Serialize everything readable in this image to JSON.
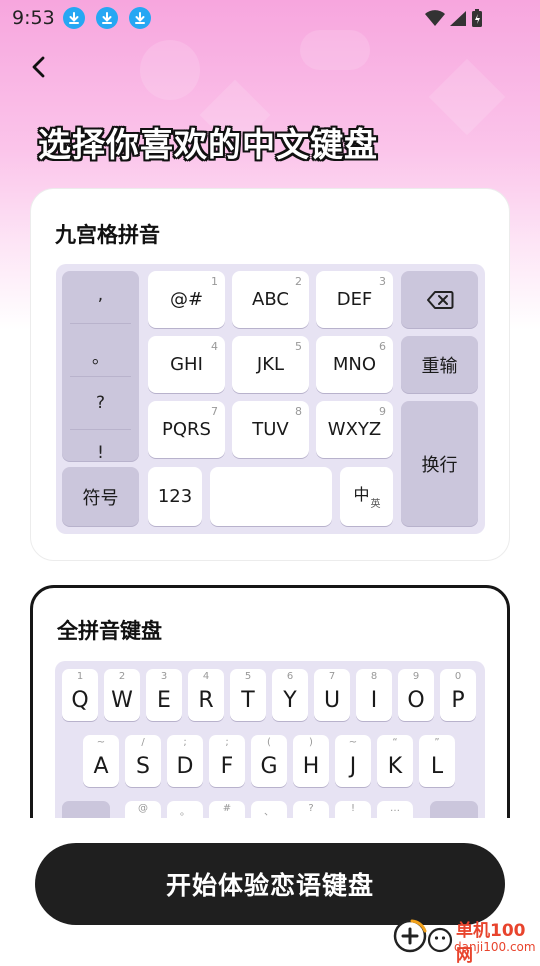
{
  "status_bar": {
    "time": "9:53"
  },
  "page": {
    "title": "选择你喜欢的中文键盘"
  },
  "card_nine": {
    "title": "九宫格拼音",
    "punctuation": [
      ",",
      "。",
      "?",
      "!"
    ],
    "symbol_key": "符号",
    "keys": [
      {
        "label": "@#",
        "num": "1"
      },
      {
        "label": "ABC",
        "num": "2"
      },
      {
        "label": "DEF",
        "num": "3"
      },
      {
        "label": "GHI",
        "num": "4"
      },
      {
        "label": "JKL",
        "num": "5"
      },
      {
        "label": "MNO",
        "num": "6"
      },
      {
        "label": "PQRS",
        "num": "7"
      },
      {
        "label": "TUV",
        "num": "8"
      },
      {
        "label": "WXYZ",
        "num": "9"
      }
    ],
    "reenter": "重输",
    "newline": "换行",
    "num_key": "123",
    "lang_main": "中",
    "lang_sub": "英"
  },
  "card_full": {
    "title": "全拼音键盘",
    "row1": [
      {
        "letter": "Q",
        "hint": "1"
      },
      {
        "letter": "W",
        "hint": "2"
      },
      {
        "letter": "E",
        "hint": "3"
      },
      {
        "letter": "R",
        "hint": "4"
      },
      {
        "letter": "T",
        "hint": "5"
      },
      {
        "letter": "Y",
        "hint": "6"
      },
      {
        "letter": "U",
        "hint": "7"
      },
      {
        "letter": "I",
        "hint": "8"
      },
      {
        "letter": "O",
        "hint": "9"
      },
      {
        "letter": "P",
        "hint": "0"
      }
    ],
    "row2": [
      {
        "letter": "A",
        "hint": "~"
      },
      {
        "letter": "S",
        "hint": "/"
      },
      {
        "letter": "D",
        "hint": ";"
      },
      {
        "letter": "F",
        "hint": ";"
      },
      {
        "letter": "G",
        "hint": "("
      },
      {
        "letter": "H",
        "hint": ")"
      },
      {
        "letter": "J",
        "hint": "~"
      },
      {
        "letter": "K",
        "hint": "“"
      },
      {
        "letter": "L",
        "hint": "”"
      }
    ],
    "row3_hints": [
      "@",
      "。",
      "#",
      "、",
      "?",
      "!",
      "…"
    ]
  },
  "cta": {
    "label": "开始体验恋语键盘"
  },
  "watermark": {
    "name": "单机100网",
    "url": "danji100.com"
  },
  "colors": {
    "accent_pink": "#f7a6de",
    "keyboard_bg": "#e7e3f3",
    "cta_bg": "#1f1f1f",
    "download_badge": "#26a7f3"
  }
}
